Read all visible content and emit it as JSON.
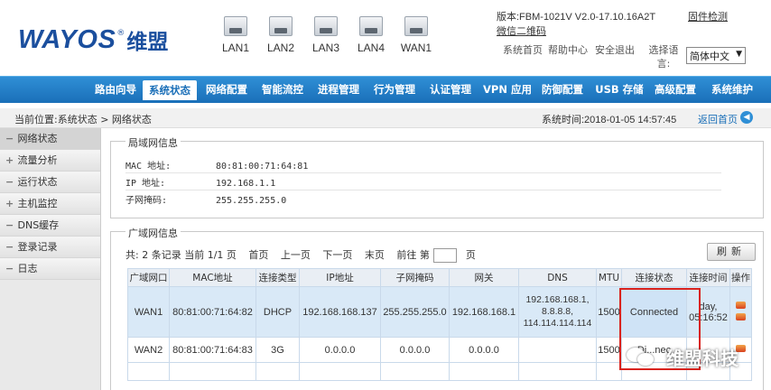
{
  "header": {
    "logo_text": "WAYOS",
    "logo_reg": "®",
    "logo_cn": "维盟",
    "ports": [
      "LAN1",
      "LAN2",
      "LAN3",
      "LAN4",
      "WAN1"
    ],
    "version": "版本:FBM-1021V V2.0-17.10.16A2T",
    "firmware_check": "固件检测",
    "wechat_qr": "微信二维码",
    "links": {
      "home": "系统首页",
      "help": "帮助中心",
      "logout": "安全退出",
      "lang_label": "选择语言:"
    },
    "language": "简体中文"
  },
  "nav": {
    "items": [
      "路由向导",
      "系统状态",
      "网络配置",
      "智能流控",
      "进程管理",
      "行为管理",
      "认证管理",
      "VPN 应用",
      "防御配置",
      "USB 存储",
      "高级配置",
      "系统维护"
    ],
    "active_index": 1
  },
  "location": {
    "breadcrumb": "当前位置:系统状态 > 网络状态",
    "system_time": "系统时间:2018-01-05 14:57:45",
    "back_home": "返回首页"
  },
  "sidebar": {
    "items": [
      {
        "sign": "−",
        "label": "网络状态"
      },
      {
        "sign": "+",
        "label": "流量分析"
      },
      {
        "sign": "−",
        "label": "运行状态"
      },
      {
        "sign": "+",
        "label": "主机监控"
      },
      {
        "sign": "−",
        "label": "DNS缓存"
      },
      {
        "sign": "−",
        "label": "登录记录"
      },
      {
        "sign": "−",
        "label": "日志"
      }
    ]
  },
  "lan": {
    "title": "局域网信息",
    "mac_label": "MAC 地址:",
    "mac": "80:81:00:71:64:81",
    "ip_label": "IP 地址:",
    "ip": "192.168.1.1",
    "mask_label": "子网掩码:",
    "mask": "255.255.255.0"
  },
  "wan": {
    "title": "广域网信息",
    "pager": {
      "summary": "共: 2 条记录 当前 1/1 页",
      "first": "首页",
      "prev": "上一页",
      "next": "下一页",
      "last": "末页",
      "goto": "前往 第",
      "page_unit": "页"
    },
    "refresh": "刷新",
    "columns": [
      "广域网口",
      "MAC地址",
      "连接类型",
      "IP地址",
      "子网掩码",
      "网关",
      "DNS",
      "MTU",
      "连接状态",
      "连接时间",
      "操作"
    ],
    "rows": [
      {
        "port": "WAN1",
        "mac": "80:81:00:71:64:82",
        "type": "DHCP",
        "ip": "192.168.168.137",
        "mask": "255.255.255.0",
        "gateway": "192.168.168.1",
        "dns": [
          "192.168.168.1,",
          "8.8.8.8,",
          "114.114.114.114"
        ],
        "mtu": "1500",
        "status": "Connected",
        "time": [
          "day,",
          "05:16:52"
        ]
      },
      {
        "port": "WAN2",
        "mac": "80:81:00:71:64:83",
        "type": "3G",
        "ip": "0.0.0.0",
        "mask": "0.0.0.0",
        "gateway": "0.0.0.0",
        "dns": [
          ""
        ],
        "mtu": "1500",
        "status": "Di...nec",
        "time": [
          ""
        ]
      }
    ]
  },
  "watermark": "维盟科技",
  "colors": {
    "nav_blue": "#1a6fb8",
    "highlight_red": "#d9231e",
    "logo_blue": "#1b4f9e"
  }
}
